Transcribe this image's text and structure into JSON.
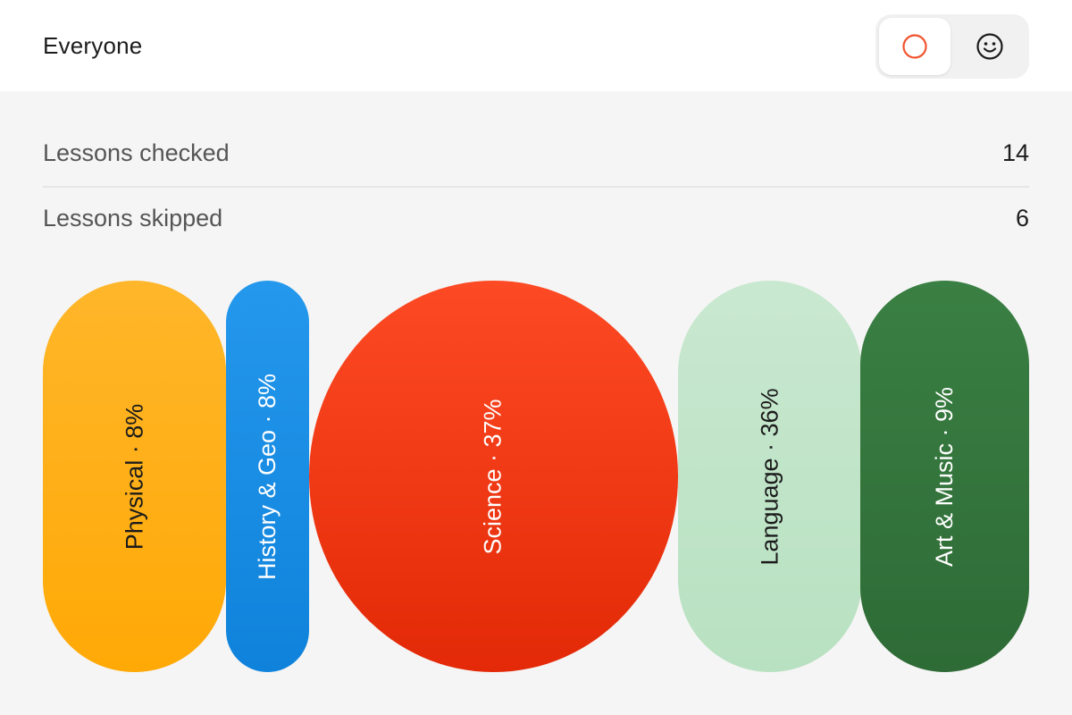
{
  "header": {
    "title": "Everyone",
    "toggle": {
      "options": [
        {
          "icon": "circle-icon",
          "active": true,
          "color": "#f0542e"
        },
        {
          "icon": "smiley-icon",
          "active": false,
          "color": "#1c1c1c"
        }
      ]
    }
  },
  "stats": [
    {
      "label": "Lessons checked",
      "value": "14"
    },
    {
      "label": "Lessons skipped",
      "value": "6"
    }
  ],
  "subjects": [
    {
      "label": "Physical · 8%",
      "color": "#ffb01a"
    },
    {
      "label": "History & Geo · 8%",
      "color": "#1a8ee4"
    },
    {
      "label": "Science · 37%",
      "color": "#f13914"
    },
    {
      "label": "Language · 36%",
      "color": "#c1e5c9"
    },
    {
      "label": "Art & Music · 9%",
      "color": "#34753d"
    }
  ]
}
